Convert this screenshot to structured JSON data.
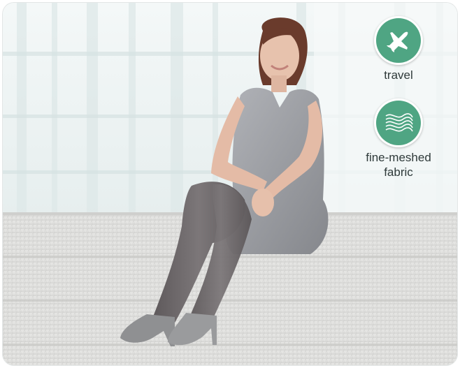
{
  "badges": {
    "travel": {
      "label": "travel",
      "icon": "airplane-icon",
      "color": "#4fa583"
    },
    "fabric": {
      "label_line1": "fine-meshed",
      "label_line2": "fabric",
      "icon": "mesh-fabric-icon",
      "color": "#4fa583"
    }
  },
  "photo": {
    "subject": "woman-in-grey-dress-and-compression-stockings",
    "palette": {
      "background": "#e9f0f0",
      "stone": "#dcdcdc",
      "dress": "#9a9ca1",
      "stocking": "#6f6a6c"
    }
  }
}
